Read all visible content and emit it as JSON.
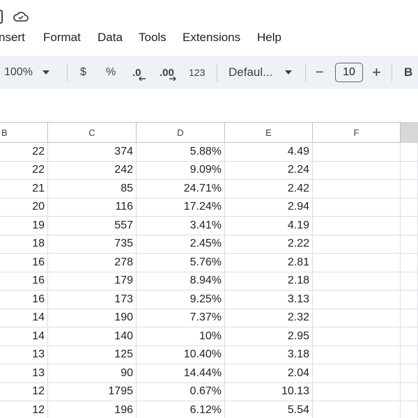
{
  "menu": [
    "nsert",
    "Format",
    "Data",
    "Tools",
    "Extensions",
    "Help"
  ],
  "toolbar": {
    "zoom": "100%",
    "currency": "$",
    "percent": "%",
    "decrease_decimal": ".0",
    "increase_decimal": ".00",
    "number_format": "123",
    "font": "Defaul...",
    "minus": "−",
    "font_size": "10",
    "plus": "+",
    "bold": "B"
  },
  "columns": [
    "B",
    "C",
    "D",
    "E",
    "F"
  ],
  "rows": [
    [
      "22",
      "374",
      "5.88%",
      "4.49",
      ""
    ],
    [
      "22",
      "242",
      "9.09%",
      "2.24",
      ""
    ],
    [
      "21",
      "85",
      "24.71%",
      "2.42",
      ""
    ],
    [
      "20",
      "116",
      "17.24%",
      "2.94",
      ""
    ],
    [
      "19",
      "557",
      "3.41%",
      "4.19",
      ""
    ],
    [
      "18",
      "735",
      "2.45%",
      "2.22",
      ""
    ],
    [
      "16",
      "278",
      "5.76%",
      "2.81",
      ""
    ],
    [
      "16",
      "179",
      "8.94%",
      "2.18",
      ""
    ],
    [
      "16",
      "173",
      "9.25%",
      "3.13",
      ""
    ],
    [
      "14",
      "190",
      "7.37%",
      "2.32",
      ""
    ],
    [
      "14",
      "140",
      "10%",
      "2.95",
      ""
    ],
    [
      "13",
      "125",
      "10.40%",
      "3.18",
      ""
    ],
    [
      "13",
      "90",
      "14.44%",
      "2.04",
      ""
    ],
    [
      "12",
      "1795",
      "0.67%",
      "10.13",
      ""
    ],
    [
      "12",
      "196",
      "6.12%",
      "5.54",
      ""
    ]
  ]
}
